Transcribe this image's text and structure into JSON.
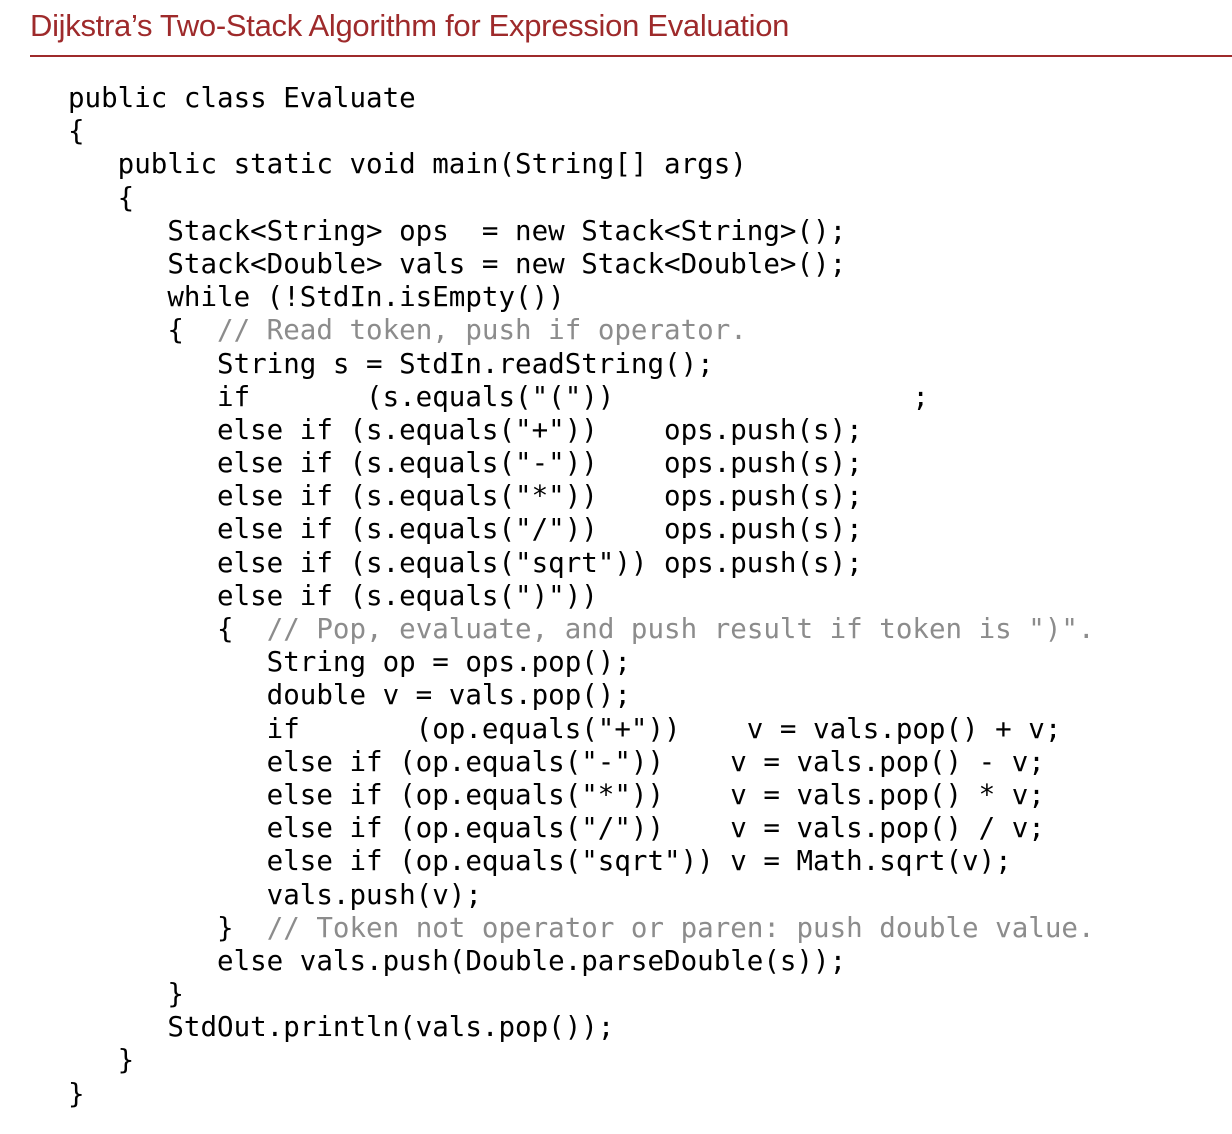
{
  "title": "Dijkstra’s Two-Stack Algorithm for Expression Evaluation",
  "colors": {
    "title": "#9e2a2b",
    "rule": "#9e2a2b",
    "code": "#000000",
    "comment": "#8c8c8c"
  },
  "code_lines": [
    {
      "code": "public class Evaluate",
      "comment": ""
    },
    {
      "code": "{",
      "comment": ""
    },
    {
      "code": "   public static void main(String[] args)",
      "comment": ""
    },
    {
      "code": "   {",
      "comment": ""
    },
    {
      "code": "      Stack<String> ops  = new Stack<String>();",
      "comment": ""
    },
    {
      "code": "      Stack<Double> vals = new Stack<Double>();",
      "comment": ""
    },
    {
      "code": "      while (!StdIn.isEmpty())",
      "comment": ""
    },
    {
      "code": "      {  ",
      "comment": "// Read token, push if operator."
    },
    {
      "code": "         String s = StdIn.readString();",
      "comment": ""
    },
    {
      "code": "         if       (s.equals(\"(\"))                  ;",
      "comment": ""
    },
    {
      "code": "         else if (s.equals(\"+\"))    ops.push(s);",
      "comment": ""
    },
    {
      "code": "         else if (s.equals(\"-\"))    ops.push(s);",
      "comment": ""
    },
    {
      "code": "         else if (s.equals(\"*\"))    ops.push(s);",
      "comment": ""
    },
    {
      "code": "         else if (s.equals(\"/\"))    ops.push(s);",
      "comment": ""
    },
    {
      "code": "         else if (s.equals(\"sqrt\")) ops.push(s);",
      "comment": ""
    },
    {
      "code": "         else if (s.equals(\")\"))",
      "comment": ""
    },
    {
      "code": "         {  ",
      "comment": "// Pop, evaluate, and push result if token is \")\"."
    },
    {
      "code": "            String op = ops.pop();",
      "comment": ""
    },
    {
      "code": "            double v = vals.pop();",
      "comment": ""
    },
    {
      "code": "            if       (op.equals(\"+\"))    v = vals.pop() + v;",
      "comment": ""
    },
    {
      "code": "            else if (op.equals(\"-\"))    v = vals.pop() - v;",
      "comment": ""
    },
    {
      "code": "            else if (op.equals(\"*\"))    v = vals.pop() * v;",
      "comment": ""
    },
    {
      "code": "            else if (op.equals(\"/\"))    v = vals.pop() / v;",
      "comment": ""
    },
    {
      "code": "            else if (op.equals(\"sqrt\")) v = Math.sqrt(v);",
      "comment": ""
    },
    {
      "code": "            vals.push(v);",
      "comment": ""
    },
    {
      "code": "         }  ",
      "comment": "// Token not operator or paren: push double value."
    },
    {
      "code": "         else vals.push(Double.parseDouble(s));",
      "comment": ""
    },
    {
      "code": "      }",
      "comment": ""
    },
    {
      "code": "      StdOut.println(vals.pop());",
      "comment": ""
    },
    {
      "code": "   }",
      "comment": ""
    },
    {
      "code": "}",
      "comment": ""
    }
  ]
}
